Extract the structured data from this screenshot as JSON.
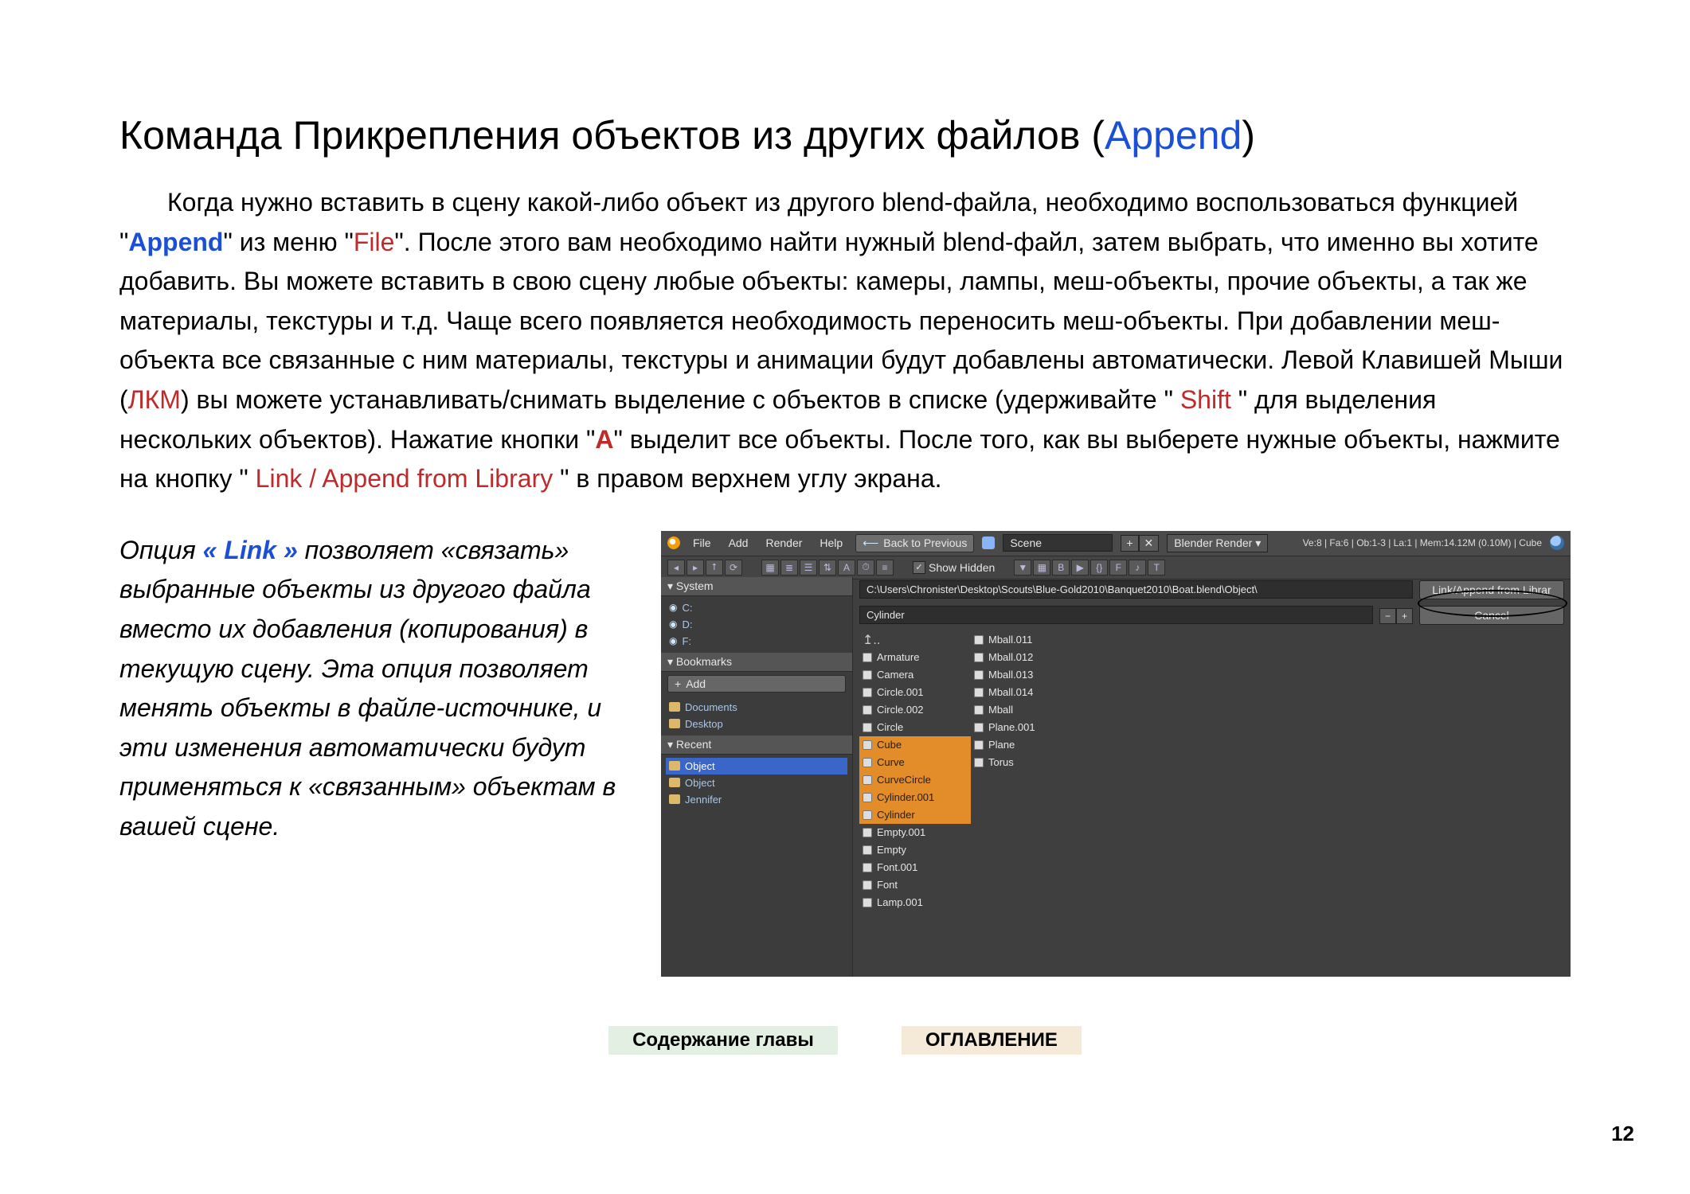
{
  "heading": {
    "prefix": "Команда Прикрепления объектов из других файлов (",
    "append": "Append",
    "suffix": ")"
  },
  "para": {
    "p1": "Когда нужно вставить в сцену какой-либо объект из другого blend-файла, необходимо воспользоваться функцией \"",
    "append": "Append",
    "p2": "\" из меню \"",
    "file": "File",
    "p3": "\". После этого вам необходимо найти нужный blend-файл, затем выбрать, что именно вы хотите добавить. Вы можете вставить в свою сцену любые объекты: камеры, лампы, меш-объекты, прочие объекты, а так же материалы, текстуры и т.д. Чаще всего появляется необходимость переносить меш-объекты. При добавлении меш-объекта все связанные с ним материалы, текстуры и анимации будут добавлены автоматически. Левой Клавишей Мыши (",
    "lkm": "ЛКМ",
    "p4": ") вы можете устанавливать/снимать выделение с объектов в списке (удерживайте \" ",
    "shift": "Shift",
    "p5": " \" для выделения нескольких объектов). Нажатие кнопки \"",
    "a": "A",
    "p6": "\" выделит все объекты. После того, как вы выберете нужные объекты, нажмите на кнопку \" ",
    "linkappend": "Link / Append from Library",
    "p7": " \" в правом верхнем углу экрана."
  },
  "sidepara": {
    "s1": "Опция ",
    "link": "« Link »",
    "s2": " позволяет «связать» выбранные объекты из другого файла вместо их добавления (копирования) в текущую сцену. Эта опция позволяет менять объекты в файле-источнике, и эти изменения автоматически будут применяться к «связанным» объектам в вашей сцене."
  },
  "shot": {
    "menubar": {
      "file": "File",
      "add": "Add",
      "render": "Render",
      "help": "Help",
      "back": "Back to Previous",
      "scene": "Scene",
      "plus": "+",
      "x": "✕",
      "engine": "Blender Render",
      "stats": "Ve:8 | Fa:6 | Ob:1-3 | La:1 | Mem:14.12M (0.10M) | Cube"
    },
    "toolbar2": {
      "showhidden": "Show Hidden"
    },
    "sidebar": {
      "system": "System",
      "c": "C:",
      "d": "D:",
      "f": "F:",
      "bookmarks": "Bookmarks",
      "add": "Add",
      "documents": "Documents",
      "desktop": "Desktop",
      "recent": "Recent",
      "object": "Object",
      "object2": "Object",
      "jennifer": "Jennifer"
    },
    "path": {
      "value": "C:\\Users\\Chronister\\Desktop\\Scouts\\Blue-Gold2010\\Banquet2010\\Boat.blend\\Object\\",
      "action": "Link/Append from Librar"
    },
    "filter": {
      "value": "Cylinder",
      "minus": "−",
      "plus": "+",
      "cancel": "Cancel"
    },
    "files": {
      "col1": [
        "↥..",
        "Armature",
        "Camera",
        "Circle.001",
        "Circle.002",
        "Circle",
        "Cube",
        "Curve",
        "CurveCircle",
        "Cylinder.001",
        "Cylinder",
        "Empty.001",
        "Empty",
        "Font.001",
        "Font",
        "Lamp.001"
      ],
      "col1_sel": [
        false,
        false,
        false,
        false,
        false,
        false,
        true,
        true,
        true,
        true,
        true,
        false,
        false,
        false,
        false,
        false
      ],
      "col2": [
        "Mball.011",
        "Mball.012",
        "Mball.013",
        "Mball.014",
        "Mball",
        "Plane.001",
        "Plane",
        "Torus"
      ],
      "col2_sel": [
        false,
        false,
        false,
        false,
        false,
        false,
        false,
        false
      ]
    }
  },
  "bottom": {
    "chapter": "Содержание главы",
    "toc": "ОГЛАВЛЕНИЕ"
  },
  "pagenum": "12"
}
